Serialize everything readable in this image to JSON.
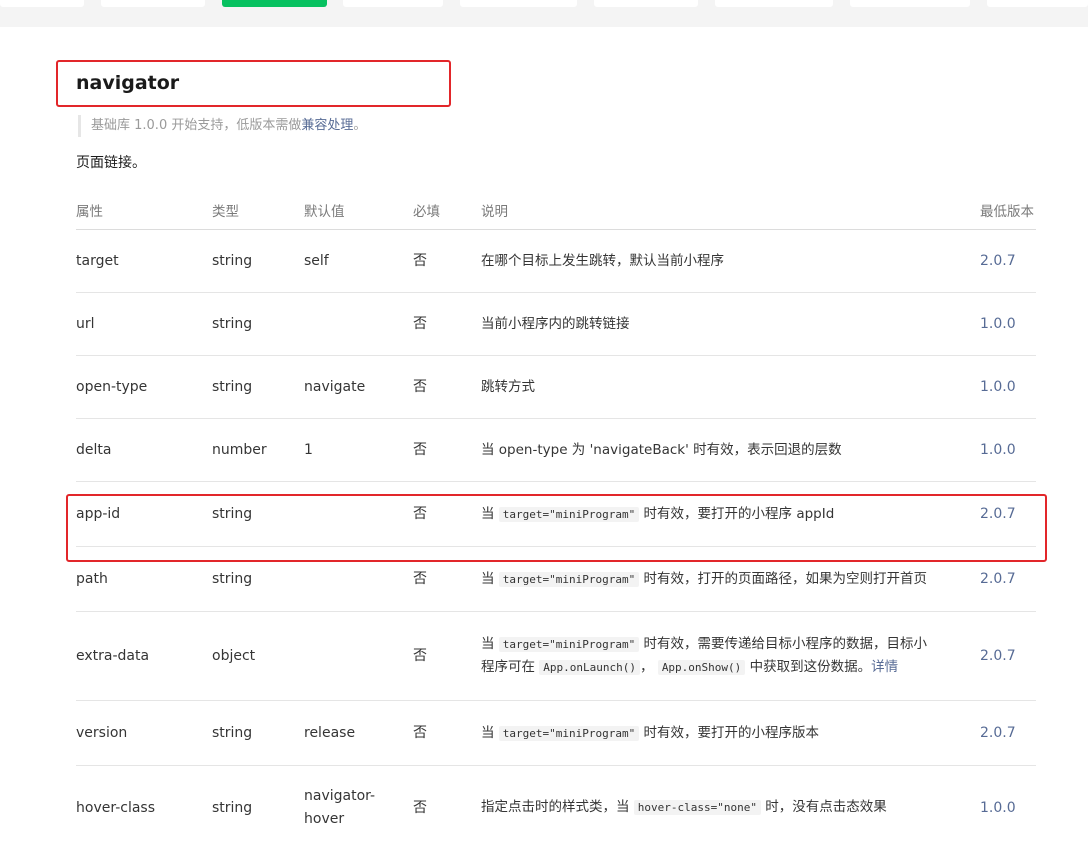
{
  "title": "navigator",
  "note": {
    "prefix": "基础库 1.0.0 开始支持，低版本需做",
    "link": "兼容处理",
    "suffix": "。"
  },
  "description": "页面链接。",
  "headers": {
    "attr": "属性",
    "type": "类型",
    "default": "默认值",
    "required": "必填",
    "desc": "说明",
    "version": "最低版本"
  },
  "rows": [
    {
      "attr": "target",
      "type": "string",
      "default": "self",
      "required": "否",
      "desc": "在哪个目标上发生跳转，默认当前小程序",
      "version": "2.0.7"
    },
    {
      "attr": "url",
      "type": "string",
      "default": "",
      "required": "否",
      "desc": "当前小程序内的跳转链接",
      "version": "1.0.0"
    },
    {
      "attr": "open-type",
      "type": "string",
      "default": "navigate",
      "required": "否",
      "desc": "跳转方式",
      "version": "1.0.0"
    },
    {
      "attr": "delta",
      "type": "number",
      "default": "1",
      "required": "否",
      "desc": "当 open-type 为 'navigateBack' 时有效，表示回退的层数",
      "version": "1.0.0"
    },
    {
      "attr": "app-id",
      "type": "string",
      "default": "",
      "required": "否",
      "desc_pre": "当 ",
      "desc_code": "target=\"miniProgram\"",
      "desc_post": " 时有效，要打开的小程序 appId",
      "version": "2.0.7"
    },
    {
      "attr": "path",
      "type": "string",
      "default": "",
      "required": "否",
      "desc_pre": "当 ",
      "desc_code": "target=\"miniProgram\"",
      "desc_post": " 时有效，打开的页面路径，如果为空则打开首页",
      "version": "2.0.7"
    },
    {
      "attr": "extra-data",
      "type": "object",
      "default": "",
      "required": "否",
      "desc_pre": "当 ",
      "desc_code": "target=\"miniProgram\"",
      "desc_post": " 时有效，需要传递给目标小程序的数据，目标小",
      "desc_l2_pre": "程序可在 ",
      "desc_code2": "App.onLaunch()",
      "desc_mid": "， ",
      "desc_code3": "App.onShow()",
      "desc_l2_post": " 中获取到这份数据。",
      "desc_link": "详情",
      "version": "2.0.7"
    },
    {
      "attr": "version",
      "type": "string",
      "default": "release",
      "required": "否",
      "desc_pre": "当 ",
      "desc_code": "target=\"miniProgram\"",
      "desc_post": " 时有效，要打开的小程序版本",
      "version": "2.0.7"
    },
    {
      "attr": "hover-class",
      "type": "string",
      "default_l1": "navigator-",
      "default_l2": "hover",
      "required": "否",
      "desc_pre": "指定点击时的样式类，当 ",
      "desc_code": "hover-class=\"none\"",
      "desc_post": " 时，没有点击态效果",
      "version": "1.0.0"
    }
  ]
}
